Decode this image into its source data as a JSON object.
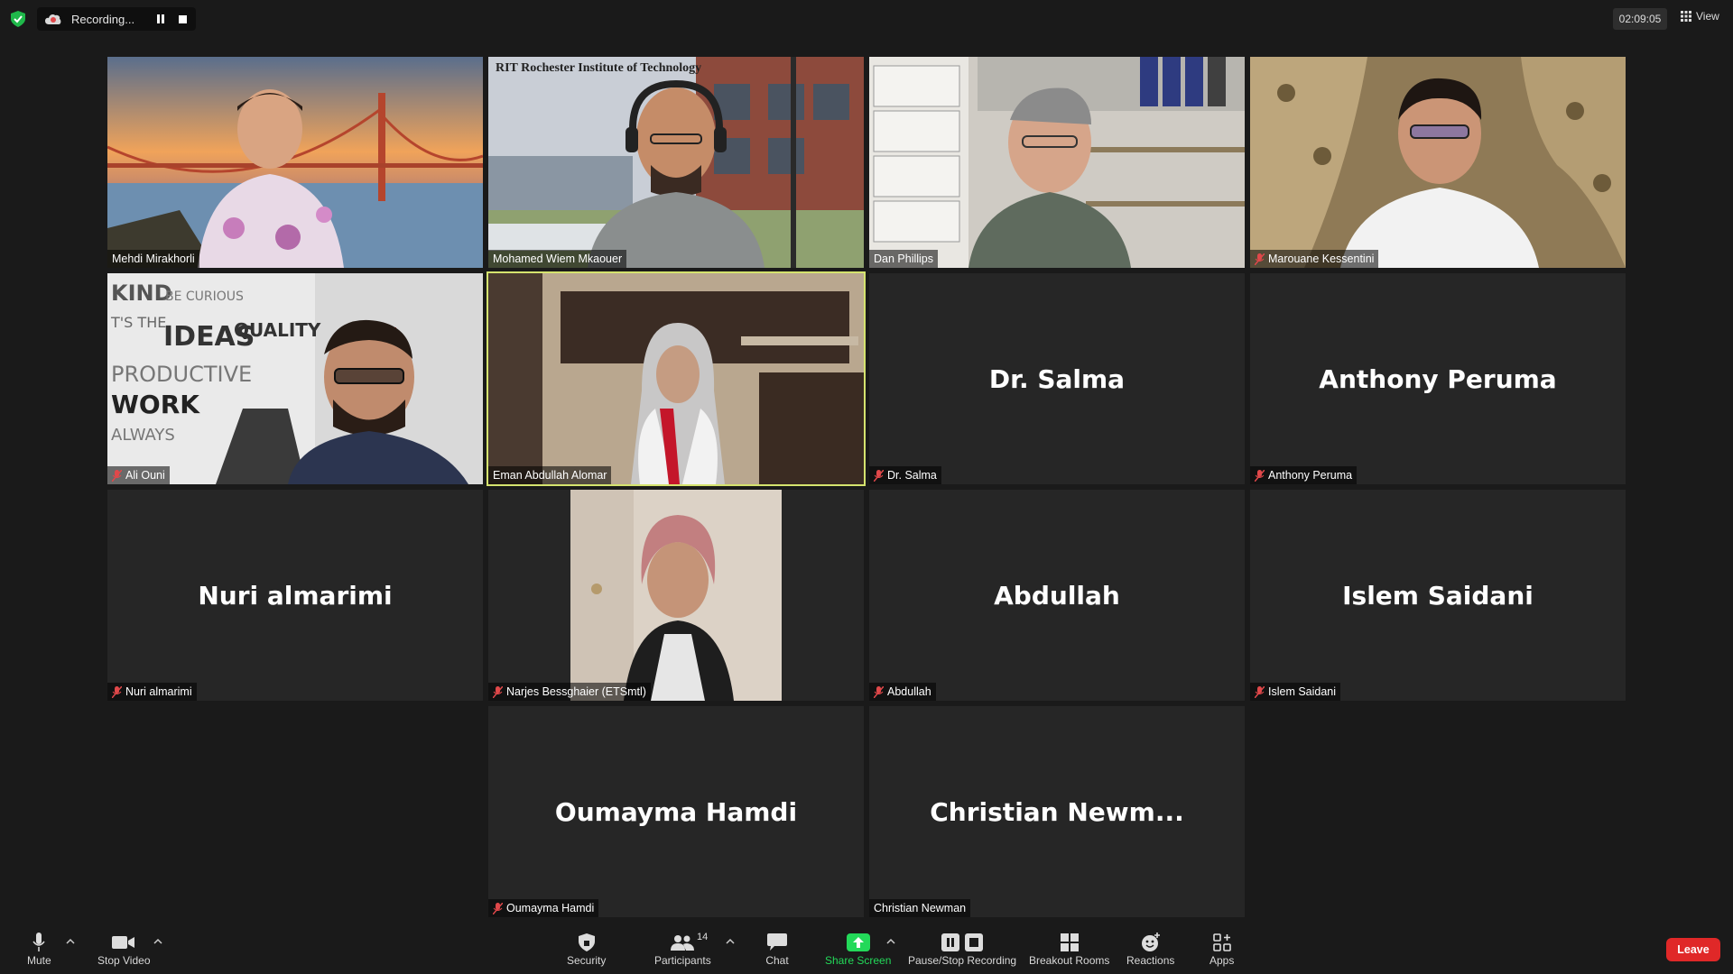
{
  "top_bar": {
    "recording_label": "Recording...",
    "timer": "02:09:05",
    "view_label": "View"
  },
  "participants": [
    {
      "name": "Mehdi Mirakhorli",
      "muted": false,
      "video": true,
      "scene": "golden-gate-bridge-background"
    },
    {
      "name": "Mohamed Wiem Mkaouer",
      "muted": false,
      "video": true,
      "scene": "rit-campus-background",
      "watermark": "RIT Rochester Institute of Technology"
    },
    {
      "name": "Dan Phillips",
      "muted": false,
      "video": true,
      "scene": "office-shelves"
    },
    {
      "name": "Marouane Kessentini",
      "muted": true,
      "video": true,
      "scene": "curtains-room"
    },
    {
      "name": "Ali Ouni",
      "muted": true,
      "video": true,
      "scene": "office-wall-words"
    },
    {
      "name": "Eman Abdullah Alomar",
      "muted": false,
      "video": true,
      "active_speaker": true,
      "scene": "office-cabinet"
    },
    {
      "name": "Dr. Salma",
      "display": "Dr. Salma",
      "muted": true,
      "video": false
    },
    {
      "name": "Anthony Peruma",
      "display": "Anthony Peruma",
      "muted": true,
      "video": false
    },
    {
      "name": "Nuri almarimi",
      "display": "Nuri almarimi",
      "muted": true,
      "video": false
    },
    {
      "name": "Narjes Bessghaier (ETSmtl)",
      "muted": true,
      "video": true,
      "scene": "portrait-photo"
    },
    {
      "name": "Abdullah",
      "display": "Abdullah",
      "muted": true,
      "video": false
    },
    {
      "name": "Islem Saidani",
      "display": "Islem Saidani",
      "muted": true,
      "video": false
    },
    {
      "name": "Oumayma Hamdi",
      "display": "Oumayma Hamdi",
      "muted": true,
      "video": false
    },
    {
      "name": "Christian Newman",
      "display": "Christian  Newm...",
      "muted": false,
      "video": false
    }
  ],
  "toolbar": {
    "mute": "Mute",
    "stop_video": "Stop Video",
    "security": "Security",
    "participants": "Participants",
    "participant_count": "14",
    "chat": "Chat",
    "share_screen": "Share Screen",
    "pause_stop_recording": "Pause/Stop Recording",
    "breakout_rooms": "Breakout Rooms",
    "reactions": "Reactions",
    "apps": "Apps",
    "leave": "Leave"
  },
  "colors": {
    "background": "#1a1a1a",
    "tile": "#262626",
    "active_speaker": "#d5e36e",
    "share_green": "#23d959",
    "leave_red": "#e02828",
    "muted_red": "#e0484a"
  }
}
